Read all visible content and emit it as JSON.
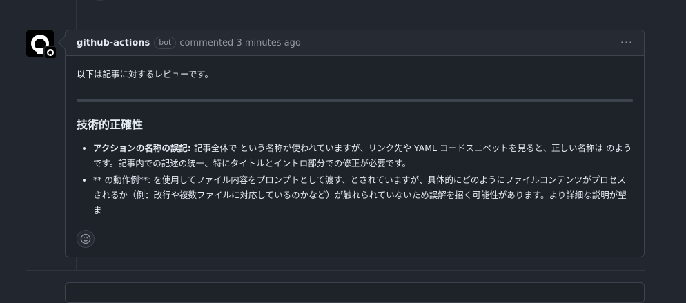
{
  "comment": {
    "author": "github-actions",
    "badge": "bot",
    "action": "commented 3 minutes ago",
    "more_label": "···",
    "intro": "以下は記事に対するレビューです。",
    "section_title": "技術的正確性",
    "bullets": [
      {
        "strong": "アクションの名称の誤記:",
        "text": " 記事全体で という名称が使われていますが、リンク先や YAML コードスニペットを見ると、正しい名称は のようです。記事内での記述の統一、特にタイトルとイントロ部分での修正が必要です。"
      },
      {
        "strong": "",
        "text": "** の動作例**: を使用してファイル内容をプロンプトとして渡す、とされていますが、具体的にどのようにファイルコンテンツがプロセスされるか（例：改行や複数ファイルに対応しているのかなど）が触れられていないため誤解を招く可能性があります。より詳細な説明が望ま"
      }
    ]
  },
  "icons": {
    "avatar": "github-octocat-icon",
    "badge": "github-app-badge-icon",
    "reaction": "smiley-icon",
    "more": "kebab-horizontal-icon"
  },
  "colors": {
    "page_bg": "#22262e",
    "box_bg": "#1e2229",
    "border": "#3d444d",
    "text": "#e6edf3",
    "muted": "#9198a1"
  }
}
